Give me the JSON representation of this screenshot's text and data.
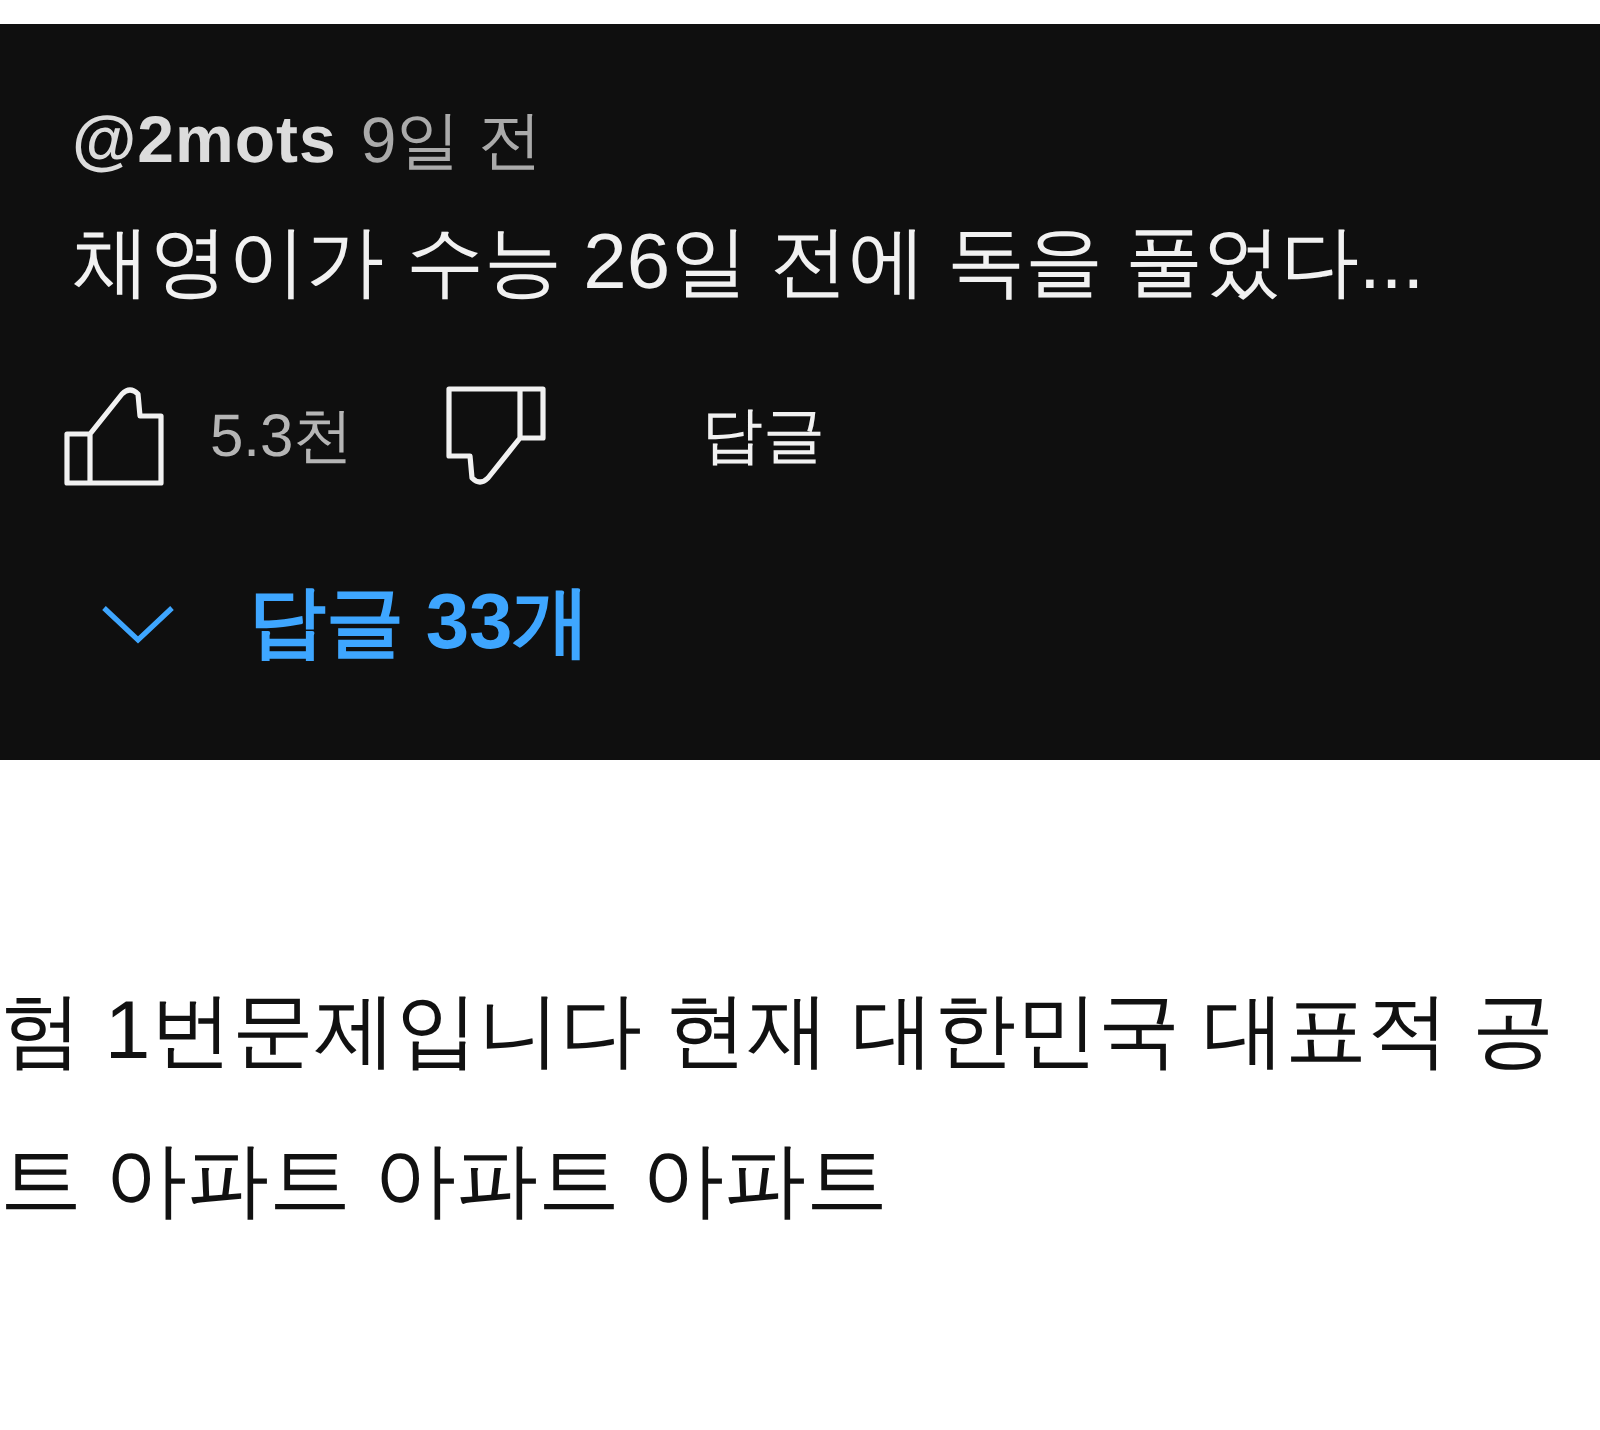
{
  "comment": {
    "author": "@2mots",
    "time": "9일 전",
    "text": "채영이가 수능 26일 전에 독을 풀었다...",
    "liked": false,
    "like_count": "5.3천",
    "disliked": false,
    "reply_button": "답글",
    "replies_toggle": {
      "expanded": false,
      "label": "답글 33개"
    }
  },
  "article": {
    "lines": [
      "험 1번문제입니다 현재 대한민국 대표적 공",
      "트 아파트 아파트 아파트"
    ]
  }
}
